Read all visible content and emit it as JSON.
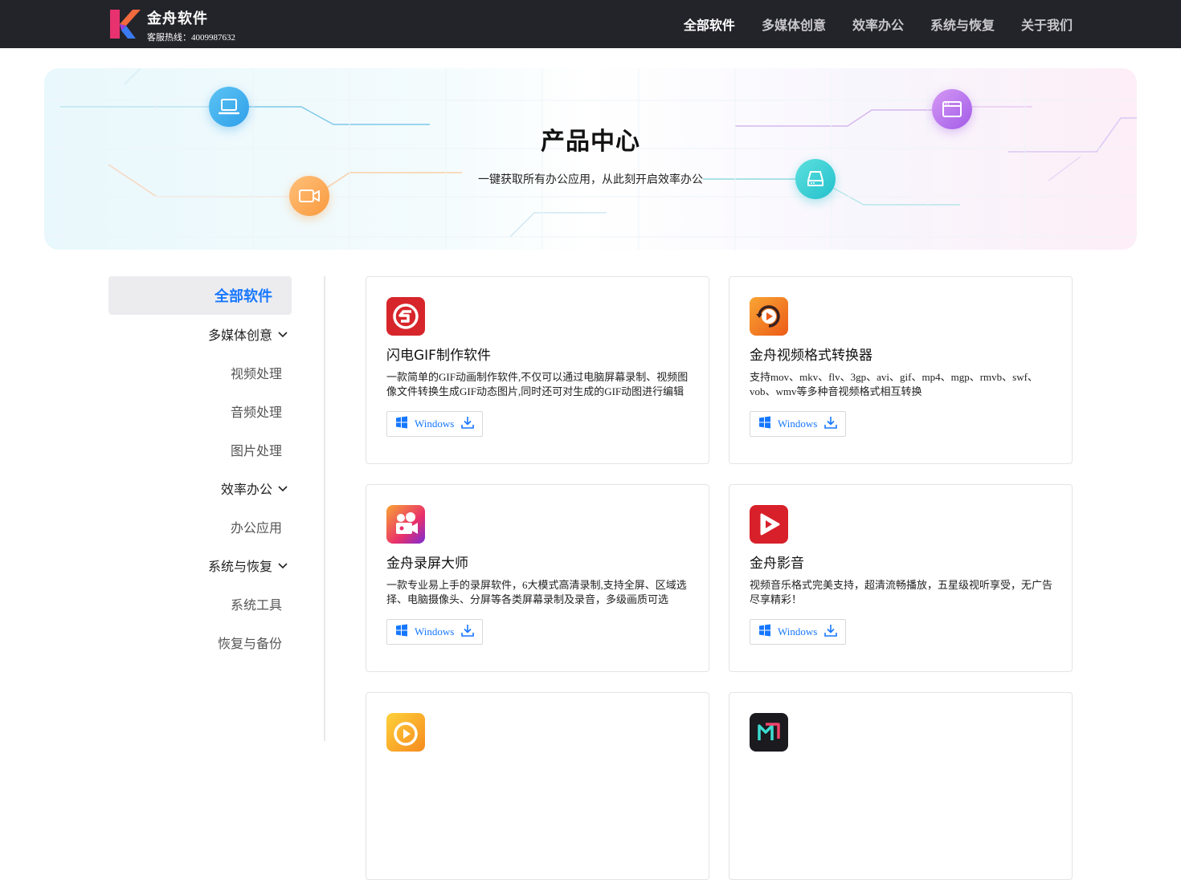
{
  "header": {
    "brand": "金舟软件",
    "hotline": "客服热线：4009987632",
    "nav": [
      {
        "label": "全部软件",
        "active": true
      },
      {
        "label": "多媒体创意",
        "active": false
      },
      {
        "label": "效率办公",
        "active": false
      },
      {
        "label": "系统与恢复",
        "active": false
      },
      {
        "label": "关于我们",
        "active": false
      }
    ]
  },
  "hero": {
    "title": "产品中心",
    "subtitle": "一键获取所有办公应用，从此刻开启效率办公",
    "icons": [
      "laptop-icon",
      "video-camera-icon",
      "browser-window-icon",
      "hard-drive-icon"
    ]
  },
  "sidebar": {
    "items": [
      {
        "label": "全部软件",
        "type": "active"
      },
      {
        "label": "多媒体创意",
        "type": "group"
      },
      {
        "label": "视频处理",
        "type": "sub"
      },
      {
        "label": "音频处理",
        "type": "sub"
      },
      {
        "label": "图片处理",
        "type": "sub"
      },
      {
        "label": "效率办公",
        "type": "group"
      },
      {
        "label": "办公应用",
        "type": "sub"
      },
      {
        "label": "系统与恢复",
        "type": "group"
      },
      {
        "label": "系统工具",
        "type": "sub"
      },
      {
        "label": "恢复与备份",
        "type": "sub"
      }
    ]
  },
  "products": [
    {
      "title": "闪电GIF制作软件",
      "desc": "一款简单的GIF动画制作软件,不仅可以通过电脑屏幕录制、视频图像文件转换生成GIF动态图片,同时还可对生成的GIF动图进行编辑",
      "platform": "Windows",
      "icon": "gif-maker-icon",
      "color": "#d7262b"
    },
    {
      "title": "金舟视频格式转换器",
      "desc": "支持mov、mkv、flv、3gp、avi、gif、mp4、mgp、rmvb、swf、vob、wmv等多种音视频格式相互转换",
      "platform": "Windows",
      "icon": "video-converter-icon",
      "color": "#f07a1a"
    },
    {
      "title": "金舟录屏大师",
      "desc": "一款专业易上手的录屏软件，6大模式高清录制,支持全屏、区域选择、电脑摄像头、分屏等各类屏幕录制及录音，多级画质可选",
      "platform": "Windows",
      "icon": "screen-recorder-icon",
      "color": "#f0573a"
    },
    {
      "title": "金舟影音",
      "desc": "视频音乐格式完美支持，超清流畅播放，五星级视听享受，无广告尽享精彩！",
      "platform": "Windows",
      "icon": "media-player-icon",
      "color": "#d8202a"
    },
    {
      "title": "",
      "desc": "",
      "platform": "",
      "icon": "orange-product-icon",
      "color": "#f5a623"
    },
    {
      "title": "",
      "desc": "",
      "platform": "",
      "icon": "dark-product-icon",
      "color": "#1a1a1f"
    }
  ],
  "colors": {
    "accent": "#1677ff",
    "topbar": "#23232a"
  }
}
